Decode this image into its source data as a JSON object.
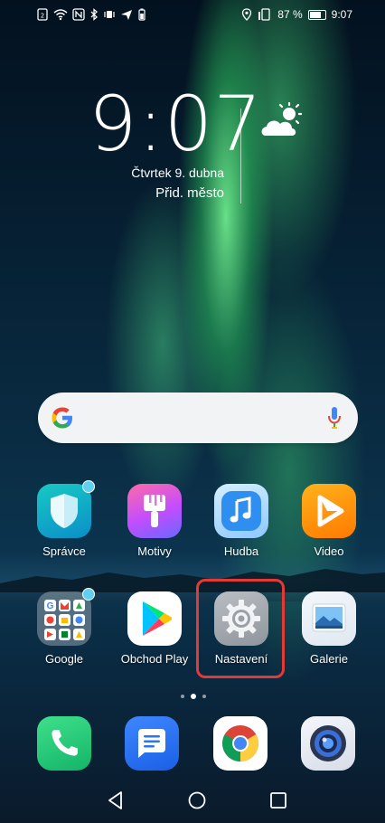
{
  "status_bar": {
    "battery_percent": "87 %",
    "time": "9:07",
    "battery_level": 0.87
  },
  "clock_widget": {
    "time": "9:07",
    "date": "Čtvrtek 9. dubna",
    "city": "Přid. město",
    "weather_icon": "partly-sunny-icon"
  },
  "search": {
    "logo": "google-g-icon",
    "mic": "microphone-icon"
  },
  "apps_row1": [
    {
      "label": "Správce",
      "icon": "shield-icon",
      "badge": true
    },
    {
      "label": "Motivy",
      "icon": "brush-icon",
      "badge": false
    },
    {
      "label": "Hudba",
      "icon": "music-note-icon",
      "badge": false
    },
    {
      "label": "Video",
      "icon": "play-icon",
      "badge": false
    }
  ],
  "apps_row2": [
    {
      "label": "Google",
      "icon": "google-folder-icon",
      "badge": true
    },
    {
      "label": "Obchod Play",
      "icon": "play-store-icon",
      "badge": false
    },
    {
      "label": "Nastavení",
      "icon": "gear-icon",
      "badge": false,
      "highlighted": true
    },
    {
      "label": "Galerie",
      "icon": "gallery-icon",
      "badge": false
    }
  ],
  "page_indicator": {
    "count": 3,
    "active": 1
  },
  "dock": [
    {
      "icon": "phone-icon"
    },
    {
      "icon": "messages-icon"
    },
    {
      "icon": "chrome-icon"
    },
    {
      "icon": "camera-icon"
    }
  ],
  "colors": {
    "highlight": "#e53935",
    "badge": "#5fd0f0"
  }
}
